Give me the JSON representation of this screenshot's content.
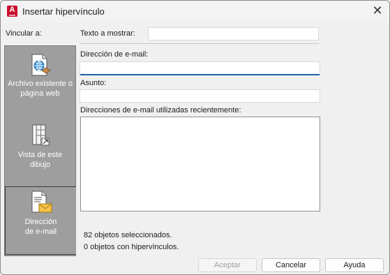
{
  "window": {
    "title": "Insertar hipervínculo",
    "app_icon_letter": "A",
    "close_glyph": "✕"
  },
  "link_to": {
    "label": "Vincular a:",
    "items": [
      {
        "label_line1": "Archivo existente o",
        "label_line2": "página web",
        "icon": "globe-document-icon",
        "selected": false
      },
      {
        "label_line1": "Vista de este",
        "label_line2": "dibujo",
        "icon": "drawing-view-icon",
        "selected": false
      },
      {
        "label_line1": "Dirección",
        "label_line2": "de e-mail",
        "icon": "email-document-icon",
        "selected": true
      }
    ]
  },
  "form": {
    "display_text_label": "Texto a mostrar:",
    "display_text_value": "",
    "email_label": "Dirección de e-mail:",
    "email_value": "",
    "subject_label": "Asunto:",
    "subject_value": "",
    "recent_label": "Direcciones de e-mail utilizadas recientemente:",
    "recent_items": []
  },
  "status": {
    "selected": "82 objetos seleccionados.",
    "with_links": "0 objetos con hipervínculos."
  },
  "buttons": {
    "accept": "Aceptar",
    "cancel": "Cancelar",
    "help": "Ayuda"
  },
  "colors": {
    "sidebar": "#9e9e9e",
    "app_icon": "#c8102e",
    "focus": "#1f5fa8"
  }
}
